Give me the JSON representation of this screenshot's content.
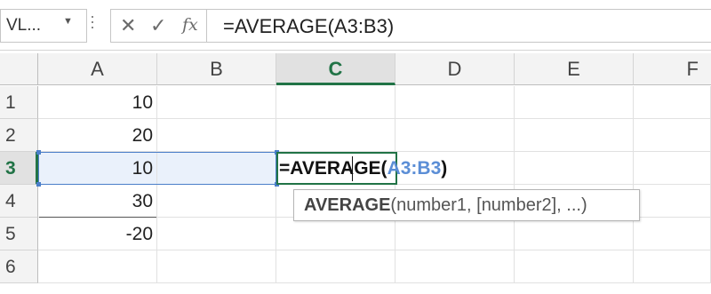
{
  "name_box": {
    "value": "VL...",
    "arrow": "▼"
  },
  "formula_bar": {
    "cancel_icon": "✕",
    "enter_icon": "✓",
    "fx_icon": "fx",
    "formula": "=AVERAGE(A3:B3)"
  },
  "columns": [
    "A",
    "B",
    "C",
    "D",
    "E",
    "F"
  ],
  "rows": [
    "1",
    "2",
    "3",
    "4",
    "5",
    "6"
  ],
  "cells": {
    "A1": "10",
    "A2": "20",
    "A3": "10",
    "A4": "30",
    "A5": "-20"
  },
  "active_cell": {
    "column": "C",
    "row": "3",
    "text_prefix": "=AVERAGE(",
    "text_ref": "A3:B3",
    "text_suffix": ")"
  },
  "tooltip": {
    "function": "AVERAGE",
    "args": "(number1, [number2], ...)"
  },
  "colors": {
    "accent_green": "#217346",
    "reference_blue": "#5b8ed6",
    "selection_fill": "#eaf1fb"
  }
}
